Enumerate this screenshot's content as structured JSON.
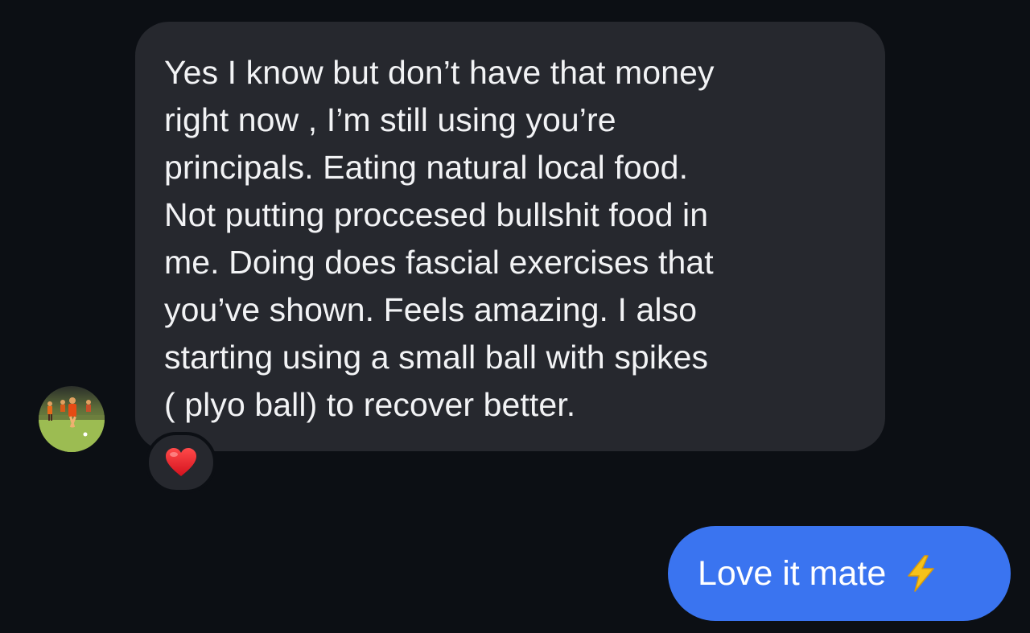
{
  "conversation": {
    "incoming_message": {
      "text": "Yes I know but don’t have that money\nright now , I’m still using you’re\nprincipals. Eating natural local food.\nNot putting proccesed bullshit food in\nme. Doing does fascial exercises that\nyou’ve shown. Feels amazing. I also\nstarting using a small ball with spikes\n( plyo ball) to recover better.",
      "reaction": "heart-emoji"
    },
    "outgoing_message": {
      "text": "Love it mate",
      "emoji": "lightning-emoji"
    }
  },
  "colors": {
    "background": "#0c0f14",
    "incoming_bubble": "#26282e",
    "outgoing_bubble": "#3a74f0",
    "text": "#f2f3f5"
  }
}
